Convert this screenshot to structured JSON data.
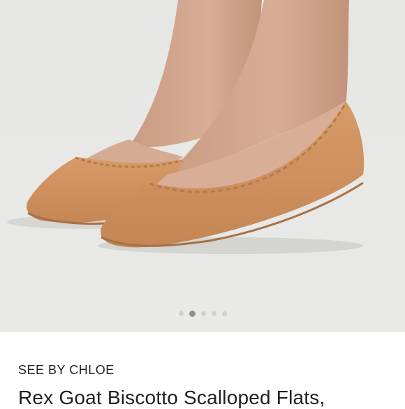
{
  "product": {
    "brand": "SEE BY CHLOE",
    "title": "Rex Goat Biscotto Scalloped Flats,"
  },
  "gallery": {
    "image_subject": "tan-leather-scalloped-ballet-flats-photo",
    "dot_count": 5,
    "active_index": 1
  },
  "colors": {
    "leather": "#cf9360",
    "leather_shadow": "#b47a4a",
    "skin": "#cfa38b",
    "background": "#e8e8e6"
  }
}
